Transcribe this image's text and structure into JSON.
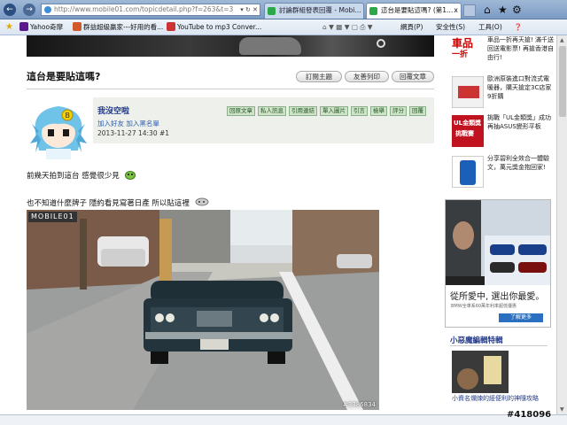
{
  "browser": {
    "url": "http://www.mobile01.com/topicdetail.php?f=263&t=3",
    "tab1_title": "討論群組發表回覆 - Mobi...",
    "tab2_title": "這台是要貼這嗎? (第1...",
    "tab_close": "x",
    "favorites": [
      {
        "label": "Yahoo奇摩",
        "icon": "yahoo-icon",
        "color": "#5b1a8c"
      },
      {
        "label": "群益超級贏家---好用的看...",
        "icon": "page-icon",
        "color": "#d05a2a"
      },
      {
        "label": "YouTube to mp3 Conver...",
        "icon": "page-icon",
        "color": "#c33"
      }
    ],
    "menus": [
      "網頁(P)",
      "安全性(S)",
      "工具(O)"
    ],
    "accent": "#5b7aa3"
  },
  "post": {
    "title": "這台是要貼這嗎?",
    "buttons": [
      "訂閱主題",
      "友善列印",
      "回覆文章"
    ],
    "username": "我沒空啦",
    "user_links": "加入好友  加入黑名單",
    "date": "2013-11-27 14:30",
    "floor": "#1",
    "user_buttons": [
      "回原文章",
      "私人訊息",
      "引用連結",
      "單入圖片",
      "引言",
      "檢舉",
      "評分",
      "回覆"
    ],
    "line1": "前幾天拍到這台 感覺很少見",
    "line2": "也不知道什麼牌子 隱約看見寫著日產 所以貼這裡",
    "photo_logo": "MOBILE01",
    "photo_id": "#3386834"
  },
  "sidebar": {
    "ad1_text": "車品一折再天搶! 滿千送回送電影票! 再搶香港自由行!",
    "ad1_badge": "車品",
    "ad1_sub": "一折",
    "ad2_text": "歐洲原裝進口對流式電暖器，購天搶定3C店家9折購",
    "ad3_text": "挑戰「UL金類獎」成功再抽ASUS變形平板",
    "ad3_badge": "UL金類獎",
    "ad3_badge2": "挑戰賽",
    "ad4_text": "分享碧利全效合一體驗文，萬元獎金抱回家!",
    "bmw_title": "從所愛中, 選出你最愛。",
    "bmw_sub": "BMW全車系60萬年利率超低優惠",
    "bmw_button": "了解更多",
    "heading": "小惡魔編輯特輯",
    "caption": "小資名爛煉的經便利的神隨攻略"
  },
  "watermark": "#418096"
}
